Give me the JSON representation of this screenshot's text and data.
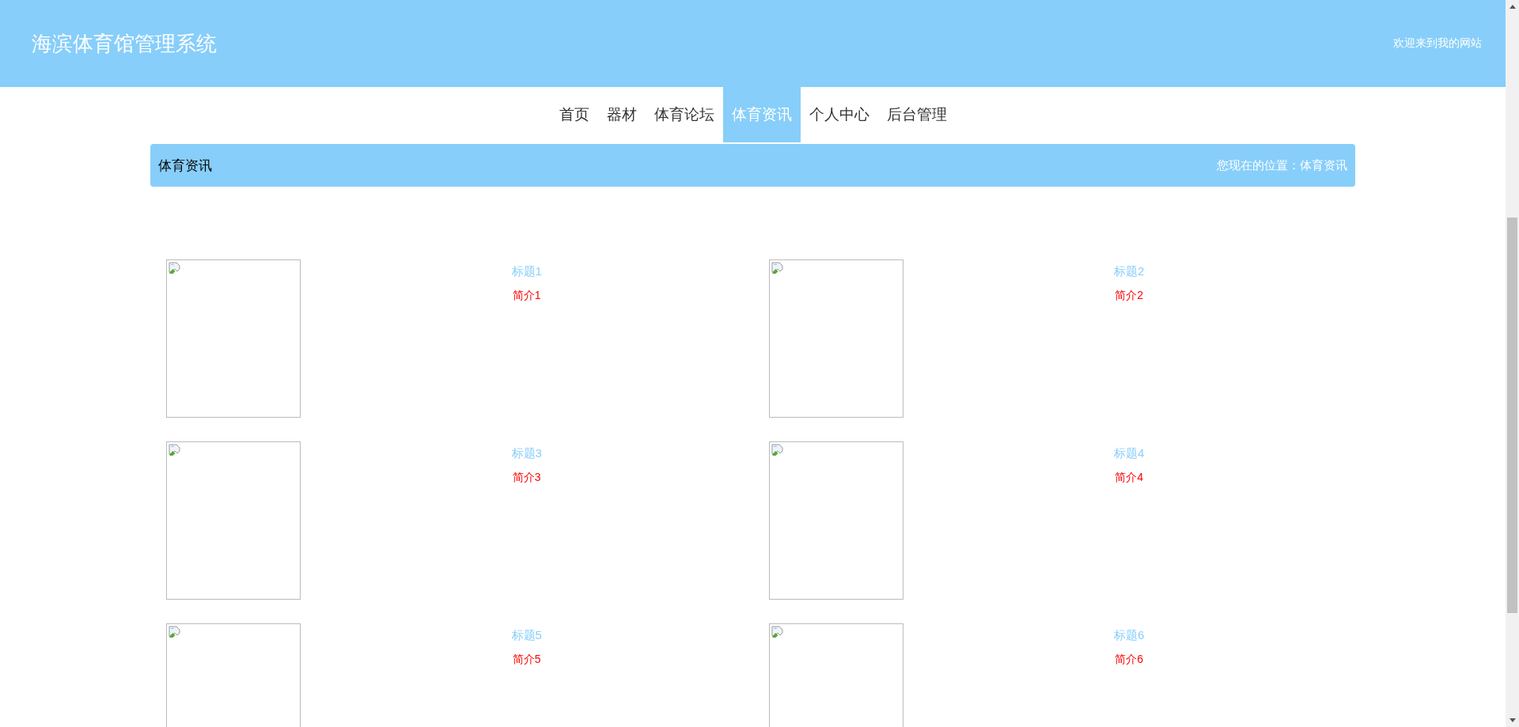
{
  "header": {
    "title": "海滨体育馆管理系统",
    "welcome": "欢迎来到我的网站"
  },
  "nav": [
    {
      "label": "首页",
      "selected": false
    },
    {
      "label": "器材",
      "selected": false
    },
    {
      "label": "体育论坛",
      "selected": false
    },
    {
      "label": "体育资讯",
      "selected": true
    },
    {
      "label": "个人中心",
      "selected": false
    },
    {
      "label": "后台管理",
      "selected": false
    }
  ],
  "breadcrumb": {
    "title": "体育资讯",
    "location": "您现在的位置：体育资讯"
  },
  "news": [
    {
      "title": "标题1",
      "summary": "简介1"
    },
    {
      "title": "标题2",
      "summary": "简介2"
    },
    {
      "title": "标题3",
      "summary": "简介3"
    },
    {
      "title": "标题4",
      "summary": "简介4"
    },
    {
      "title": "标题5",
      "summary": "简介5"
    },
    {
      "title": "标题6",
      "summary": "简介6"
    }
  ]
}
